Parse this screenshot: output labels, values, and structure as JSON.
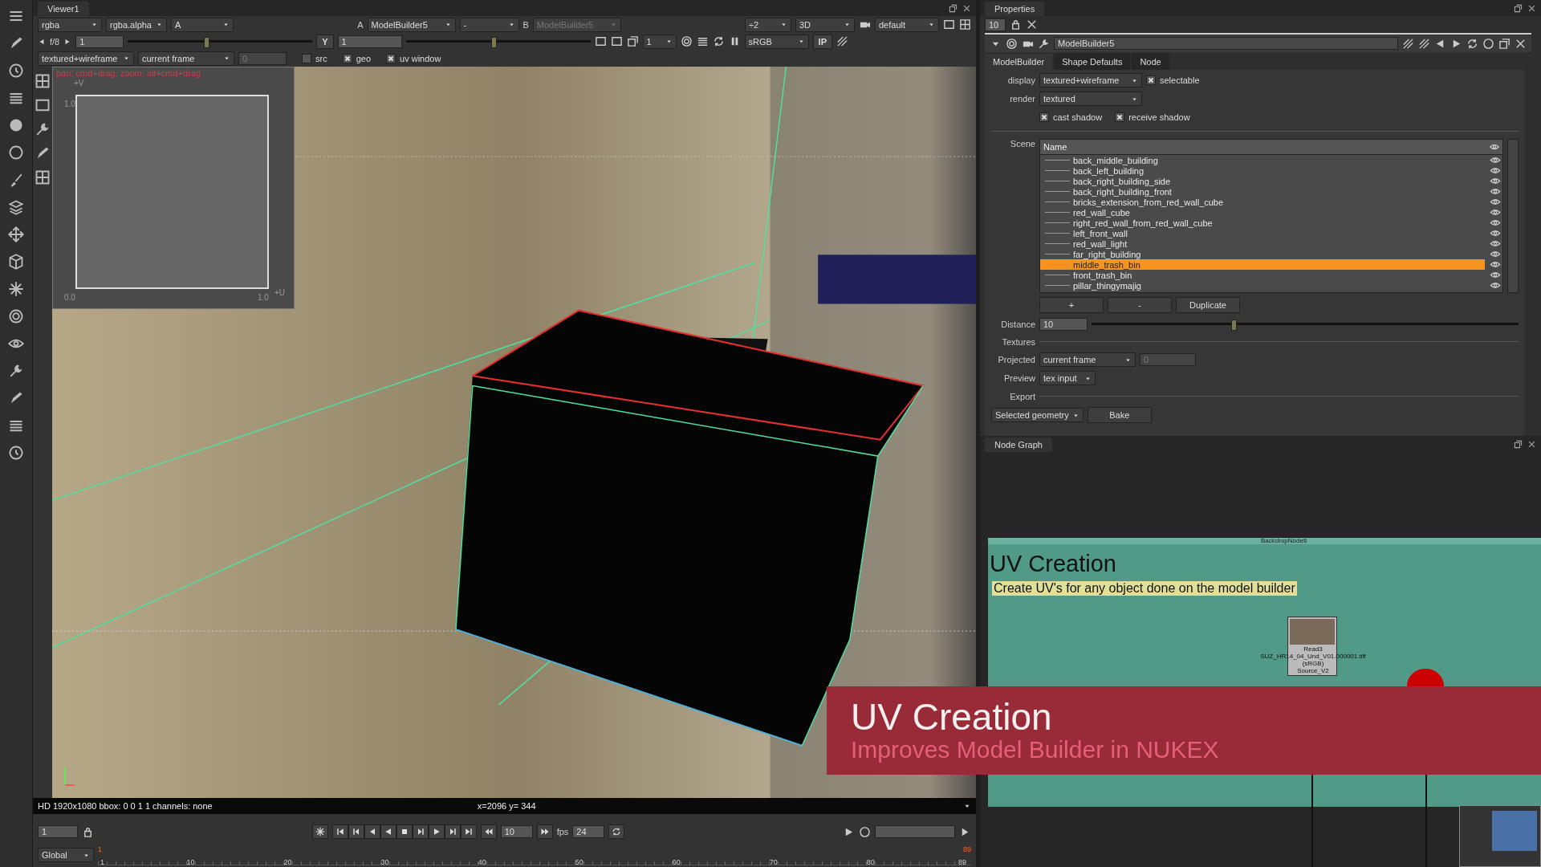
{
  "viewer": {
    "title": "Viewer1",
    "row1": {
      "channels": "rgba",
      "alpha": "rgba.alpha",
      "display": "A",
      "a_label": "A",
      "input_a": "ModelBuilder5",
      "merge": "-",
      "b_label": "B",
      "input_b": {
        "value": "ModelBuilder5",
        "disabled": true
      },
      "downscale": "÷2",
      "view": "3D",
      "lut": "default"
    },
    "row2": {
      "fstop": "f/8",
      "gain": "1",
      "gain_slider": {
        "level": 0.42
      },
      "gamma_label": "Y",
      "gamma": "1",
      "gamma_slider": {
        "level": 0.47
      },
      "proxy": "1",
      "colorspace": "sRGB",
      "ip": "IP"
    },
    "row3": {
      "display_mode": "textured+wireframe",
      "frame_mode": "current frame",
      "frame": "0",
      "checkboxes": [
        {
          "label": "src",
          "checked": false
        },
        {
          "label": "geo",
          "checked": true
        },
        {
          "label": "uv window",
          "checked": true
        }
      ]
    },
    "uv_window": {
      "hint": "pan: cmd+drag, zoom: alt+cmd+drag",
      "v_axis": "+V",
      "v_max": "1.0",
      "origin": "0.0",
      "u_max": "1.0",
      "u_axis": "+U"
    },
    "status": {
      "info": "HD 1920x1080 bbox: 0 0 1 1 channels: none",
      "coords": "x=2096 y= 344"
    },
    "playback": {
      "frame": "1",
      "increment": "10",
      "fps_label": "fps",
      "fps": "24"
    },
    "timeline": {
      "range": "Global",
      "start_marker": "1",
      "end_marker": "89",
      "ticks": [
        "1",
        "10",
        "20",
        "30",
        "40",
        "50",
        "60",
        "70",
        "80",
        "89"
      ]
    }
  },
  "properties": {
    "title": "Properties",
    "max_panels": "10",
    "node_name": "ModelBuilder5",
    "tabs": [
      {
        "label": "ModelBuilder",
        "selected": true
      },
      {
        "label": "Shape Defaults",
        "selected": false
      },
      {
        "label": "Node",
        "selected": false
      }
    ],
    "display": {
      "label": "display",
      "value": "textured+wireframe"
    },
    "selectable": {
      "label": "selectable",
      "checked": true
    },
    "render": {
      "label": "render",
      "value": "textured"
    },
    "cast_shadow": {
      "label": "cast shadow",
      "checked": true
    },
    "receive_shadow": {
      "label": "receive shadow",
      "checked": true
    },
    "scene": {
      "label": "Scene",
      "column": "Name",
      "items": [
        {
          "name": "back_middle_building",
          "selected": false
        },
        {
          "name": "back_left_building",
          "selected": false
        },
        {
          "name": "back_right_building_side",
          "selected": false
        },
        {
          "name": "back_right_building_front",
          "selected": false
        },
        {
          "name": "bricks_extension_from_red_wall_cube",
          "selected": false
        },
        {
          "name": "red_wall_cube",
          "selected": false
        },
        {
          "name": "right_red_wall_from_red_wall_cube",
          "selected": false
        },
        {
          "name": "left_front_wall",
          "selected": false
        },
        {
          "name": "red_wall_light",
          "selected": false
        },
        {
          "name": "far_right_building",
          "selected": false
        },
        {
          "name": "middle_trash_bin",
          "selected": true
        },
        {
          "name": "front_trash_bin",
          "selected": false
        },
        {
          "name": "pillar_thingymajig",
          "selected": false
        }
      ]
    },
    "scene_buttons": [
      "+",
      "-",
      "Duplicate"
    ],
    "distance": {
      "label": "Distance",
      "value": "10",
      "level": 0.33
    },
    "textures": "Textures",
    "projected": {
      "label": "Projected",
      "value": "current frame",
      "frame": "0"
    },
    "preview": {
      "label": "Preview",
      "value": "tex input"
    },
    "export": "Export",
    "export_mode": "Selected geometry",
    "bake": "Bake"
  },
  "node_graph": {
    "title": "Node Graph",
    "backdrop": {
      "label": "BackdropNode6",
      "heading": "UV Creation",
      "note": "Create UV's for any object done on the model builder"
    },
    "read_node": {
      "lines": [
        "Read3",
        "SUZ_HR14_04_Und_V01.000001.tiff",
        "(sRGB)",
        "Source_V2"
      ]
    }
  },
  "banner": {
    "title": "UV Creation",
    "subtitle": "Improves Model Builder in NUKEX"
  }
}
